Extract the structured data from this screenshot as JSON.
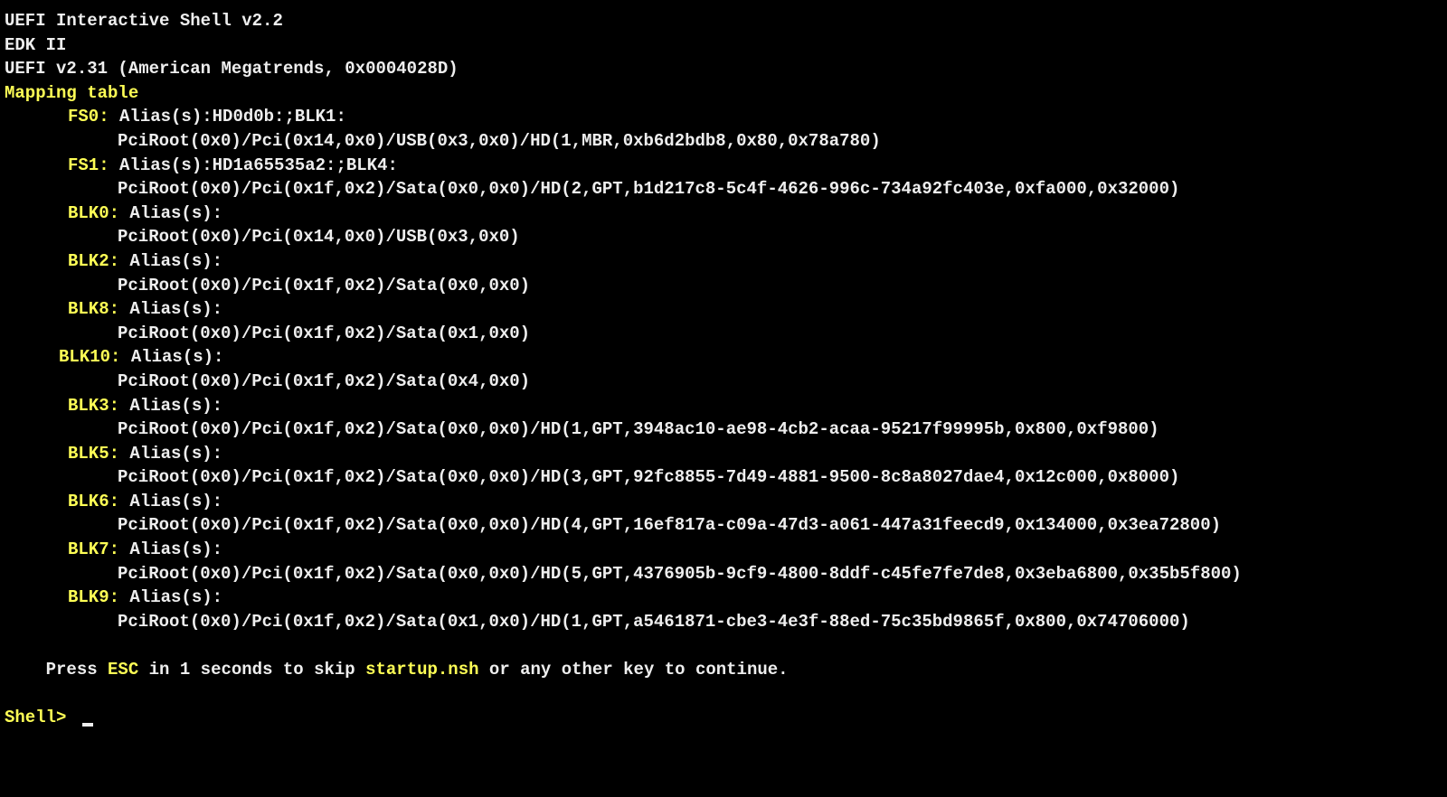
{
  "header": {
    "title": "UEFI Interactive Shell v2.2",
    "edk": "EDK II",
    "uefi_version": "UEFI v2.31 (American Megatrends, 0x0004028D)",
    "mapping_table": "Mapping table"
  },
  "mappings": [
    {
      "name": "FS0:",
      "alias_label": "Alias(s):",
      "alias": "HD0d0b:;BLK1:",
      "path": "PciRoot(0x0)/Pci(0x14,0x0)/USB(0x3,0x0)/HD(1,MBR,0xb6d2bdb8,0x80,0x78a780)",
      "indent": "indent1"
    },
    {
      "name": "FS1:",
      "alias_label": "Alias(s):",
      "alias": "HD1a65535a2:;BLK4:",
      "path": "PciRoot(0x0)/Pci(0x1f,0x2)/Sata(0x0,0x0)/HD(2,GPT,b1d217c8-5c4f-4626-996c-734a92fc403e,0xfa000,0x32000)",
      "indent": "indent1"
    },
    {
      "name": "BLK0:",
      "alias_label": "Alias(s):",
      "alias": "",
      "path": "PciRoot(0x0)/Pci(0x14,0x0)/USB(0x3,0x0)",
      "indent": "indent1"
    },
    {
      "name": "BLK2:",
      "alias_label": "Alias(s):",
      "alias": "",
      "path": "PciRoot(0x0)/Pci(0x1f,0x2)/Sata(0x0,0x0)",
      "indent": "indent1"
    },
    {
      "name": "BLK8:",
      "alias_label": "Alias(s):",
      "alias": "",
      "path": "PciRoot(0x0)/Pci(0x1f,0x2)/Sata(0x1,0x0)",
      "indent": "indent1"
    },
    {
      "name": "BLK10:",
      "alias_label": "Alias(s):",
      "alias": "",
      "path": "PciRoot(0x0)/Pci(0x1f,0x2)/Sata(0x4,0x0)",
      "indent": "indent3"
    },
    {
      "name": "BLK3:",
      "alias_label": "Alias(s):",
      "alias": "",
      "path": "PciRoot(0x0)/Pci(0x1f,0x2)/Sata(0x0,0x0)/HD(1,GPT,3948ac10-ae98-4cb2-acaa-95217f99995b,0x800,0xf9800)",
      "indent": "indent1"
    },
    {
      "name": "BLK5:",
      "alias_label": "Alias(s):",
      "alias": "",
      "path": "PciRoot(0x0)/Pci(0x1f,0x2)/Sata(0x0,0x0)/HD(3,GPT,92fc8855-7d49-4881-9500-8c8a8027dae4,0x12c000,0x8000)",
      "indent": "indent1"
    },
    {
      "name": "BLK6:",
      "alias_label": "Alias(s):",
      "alias": "",
      "path": "PciRoot(0x0)/Pci(0x1f,0x2)/Sata(0x0,0x0)/HD(4,GPT,16ef817a-c09a-47d3-a061-447a31feecd9,0x134000,0x3ea72800)",
      "indent": "indent1"
    },
    {
      "name": "BLK7:",
      "alias_label": "Alias(s):",
      "alias": "",
      "path": "PciRoot(0x0)/Pci(0x1f,0x2)/Sata(0x0,0x0)/HD(5,GPT,4376905b-9cf9-4800-8ddf-c45fe7fe7de8,0x3eba6800,0x35b5f800)",
      "indent": "indent1"
    },
    {
      "name": "BLK9:",
      "alias_label": "Alias(s):",
      "alias": "",
      "path": "PciRoot(0x0)/Pci(0x1f,0x2)/Sata(0x1,0x0)/HD(1,GPT,a5461871-cbe3-4e3f-88ed-75c35bd9865f,0x800,0x74706000)",
      "indent": "indent1"
    }
  ],
  "footer": {
    "press": "Press ",
    "esc": "ESC",
    "mid": " in 1 seconds to skip ",
    "startup": "startup.nsh",
    "end": " or any other key to continue."
  },
  "prompt": {
    "label": "Shell> "
  }
}
